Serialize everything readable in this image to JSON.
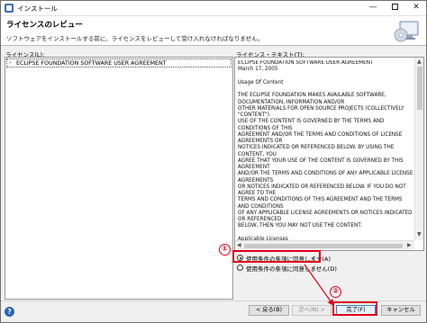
{
  "window": {
    "title": "インストール",
    "controls": {
      "minimize": "—",
      "maximize": "",
      "close": "✕"
    }
  },
  "banner": {
    "title": "ライセンスのレビュー",
    "description": "ソフトウェアをインストールする前に、ライセンスをレビューして受け入れなければなりません。",
    "graphic_icon": "install-cd-monitor-icon"
  },
  "licenses": {
    "label": "ライセンス(L):",
    "items": [
      {
        "arrow": "›",
        "label": "ECLIPSE FOUNDATION SOFTWARE USER AGREEMENT"
      }
    ]
  },
  "license_text": {
    "label": "ライセンス・テキスト(T):",
    "body": "ECLIPSE FOUNDATION SOFTWARE USER AGREEMENT\nMarch 17, 2005\n\nUsage Of Content\n\nTHE ECLIPSE FOUNDATION MAKES AVAILABLE SOFTWARE,\nDOCUMENTATION, INFORMATION AND/OR\nOTHER MATERIALS FOR OPEN SOURCE PROJECTS (COLLECTIVELY\n\"CONTENT\").\nUSE OF THE CONTENT IS GOVERNED BY THE TERMS AND CONDITIONS OF THIS\nAGREEMENT AND/OR THE TERMS AND CONDITIONS OF LICENSE AGREEMENTS OR\nNOTICES INDICATED OR REFERENCED BELOW. BY USING THE CONTENT, YOU\nAGREE THAT YOUR USE OF THE CONTENT IS GOVERNED BY THIS AGREEMENT\nAND/OR THE TERMS AND CONDITIONS OF ANY APPLICABLE LICENSE AGREEMENTS\nOR NOTICES INDICATED OR REFERENCED BELOW. IF YOU DO NOT AGREE TO THE\nTERMS AND CONDITIONS OF THIS AGREEMENT AND THE TERMS AND CONDITIONS\nOF ANY APPLICABLE LICENSE AGREEMENTS OR NOTICES INDICATED OR REFERENCED\nBELOW, THEN YOU MAY NOT USE THE CONTENT.\n\nApplicable Licenses"
  },
  "options": {
    "accept": {
      "label": "使用条件の条項に同意します(A)",
      "selected": true
    },
    "decline": {
      "label": "使用条件の条項に同意しません(D)",
      "selected": false
    }
  },
  "annotations": {
    "step1": "①",
    "step2": "②",
    "highlight_color": "#e0001b"
  },
  "buttons": {
    "help": "?",
    "back": "< 戻る(B)",
    "next": "次へ(N) >",
    "finish": "完了(F)",
    "cancel": "キャンセル"
  }
}
